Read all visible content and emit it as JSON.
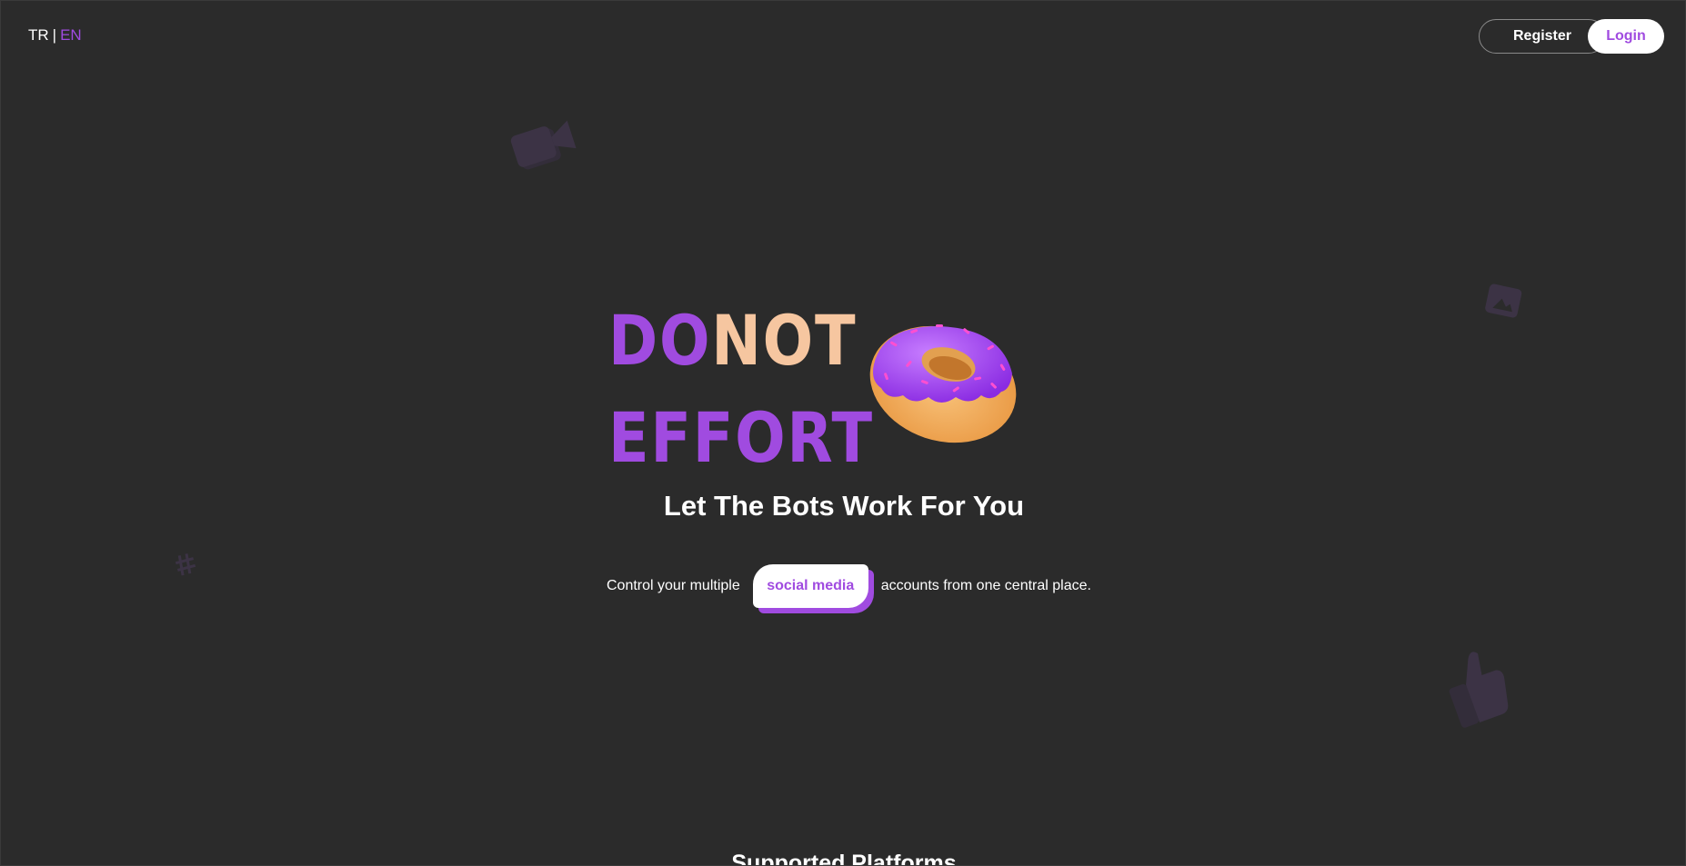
{
  "header": {
    "lang_tr": "TR",
    "lang_separator": "|",
    "lang_en": "EN",
    "register_label": "Register",
    "login_label": "Login"
  },
  "hero": {
    "logo_line1_part1": "DO",
    "logo_line1_part2": "NOT",
    "logo_line2": "EFFORT",
    "tagline": "Let The Bots Work For You",
    "subline_before": "Control your multiple",
    "subline_highlight": "social media",
    "subline_after": "accounts from one central place."
  },
  "sections": {
    "supported_platforms_heading": "Supported Platforms"
  },
  "colors": {
    "accent": "#a04be0",
    "peach": "#f6c6a0",
    "background": "#2b2b2b"
  },
  "decorations": [
    "camera-icon",
    "image-icon",
    "hashtag-icon",
    "thumbs-up-icon",
    "donut-image"
  ]
}
